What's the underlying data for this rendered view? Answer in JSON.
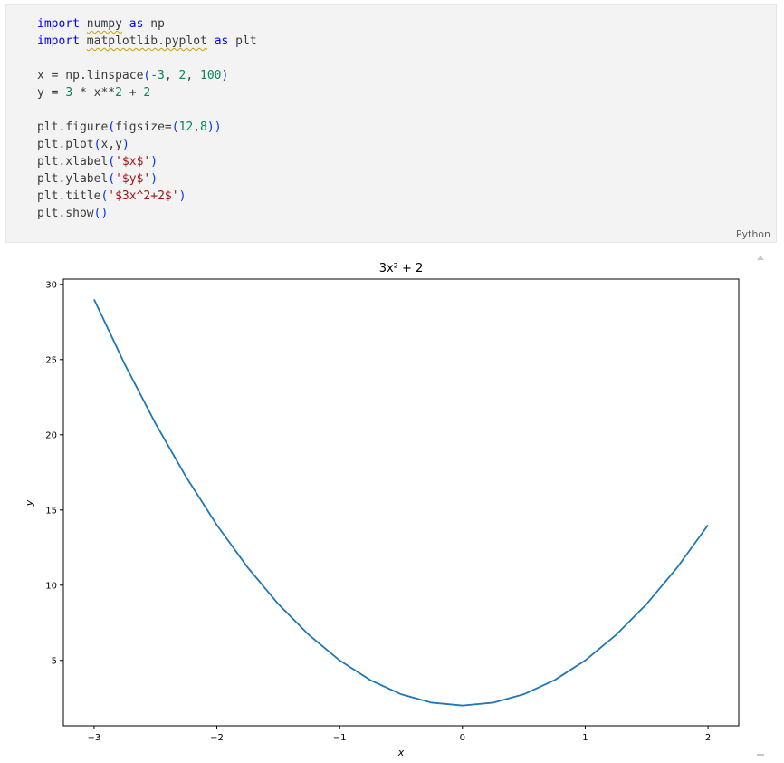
{
  "code_cell": {
    "language": "Python",
    "lines": {
      "l1": [
        "import",
        "numpy",
        "as",
        "np"
      ],
      "l2": [
        "import",
        "matplotlib.pyplot",
        "as",
        "plt"
      ],
      "l4": [
        "x = np.linspace",
        "(",
        "-3",
        ", ",
        "2",
        ", ",
        "100",
        ")"
      ],
      "l5": [
        "y = ",
        "3",
        " * x**",
        "2",
        " + ",
        "2"
      ],
      "l7": [
        "plt.figure",
        "(",
        "figsize=",
        "(",
        "12",
        ",",
        "8",
        ")",
        ")"
      ],
      "l8": [
        "plt.plot",
        "(",
        "x,y",
        ")"
      ],
      "l9": [
        "plt.xlabel",
        "(",
        "'$x$'",
        ")"
      ],
      "l10": [
        "plt.ylabel",
        "(",
        "'$y$'",
        ")"
      ],
      "l11": [
        "plt.title",
        "(",
        "'$3x^2+2$'",
        ")"
      ],
      "l12": [
        "plt.show",
        "()"
      ]
    }
  },
  "chart_data": {
    "type": "line",
    "title": "3x² + 2",
    "xlabel": "x",
    "ylabel": "y",
    "xlim": [
      -3.25,
      2.25
    ],
    "ylim": [
      0.65,
      30.35
    ],
    "x_ticks": [
      -3,
      -2,
      -1,
      0,
      1,
      2
    ],
    "y_ticks": [
      5,
      10,
      15,
      20,
      25,
      30
    ],
    "x_tick_labels": [
      "−3",
      "−2",
      "−1",
      "0",
      "1",
      "2"
    ],
    "y_tick_labels": [
      "5",
      "10",
      "15",
      "20",
      "25",
      "30"
    ],
    "grid": false,
    "line_color": "#1f77b4",
    "series": [
      {
        "x": [
          -3,
          -2.75,
          -2.5,
          -2.25,
          -2,
          -1.75,
          -1.5,
          -1.25,
          -1,
          -0.75,
          -0.5,
          -0.25,
          0,
          0.25,
          0.5,
          0.75,
          1,
          1.25,
          1.5,
          1.75,
          2
        ],
        "values": [
          29,
          24.69,
          20.75,
          17.19,
          14,
          11.19,
          8.75,
          6.69,
          5,
          3.69,
          2.75,
          2.19,
          2,
          2.19,
          2.75,
          3.69,
          5,
          6.69,
          8.75,
          11.19,
          14
        ]
      }
    ]
  }
}
